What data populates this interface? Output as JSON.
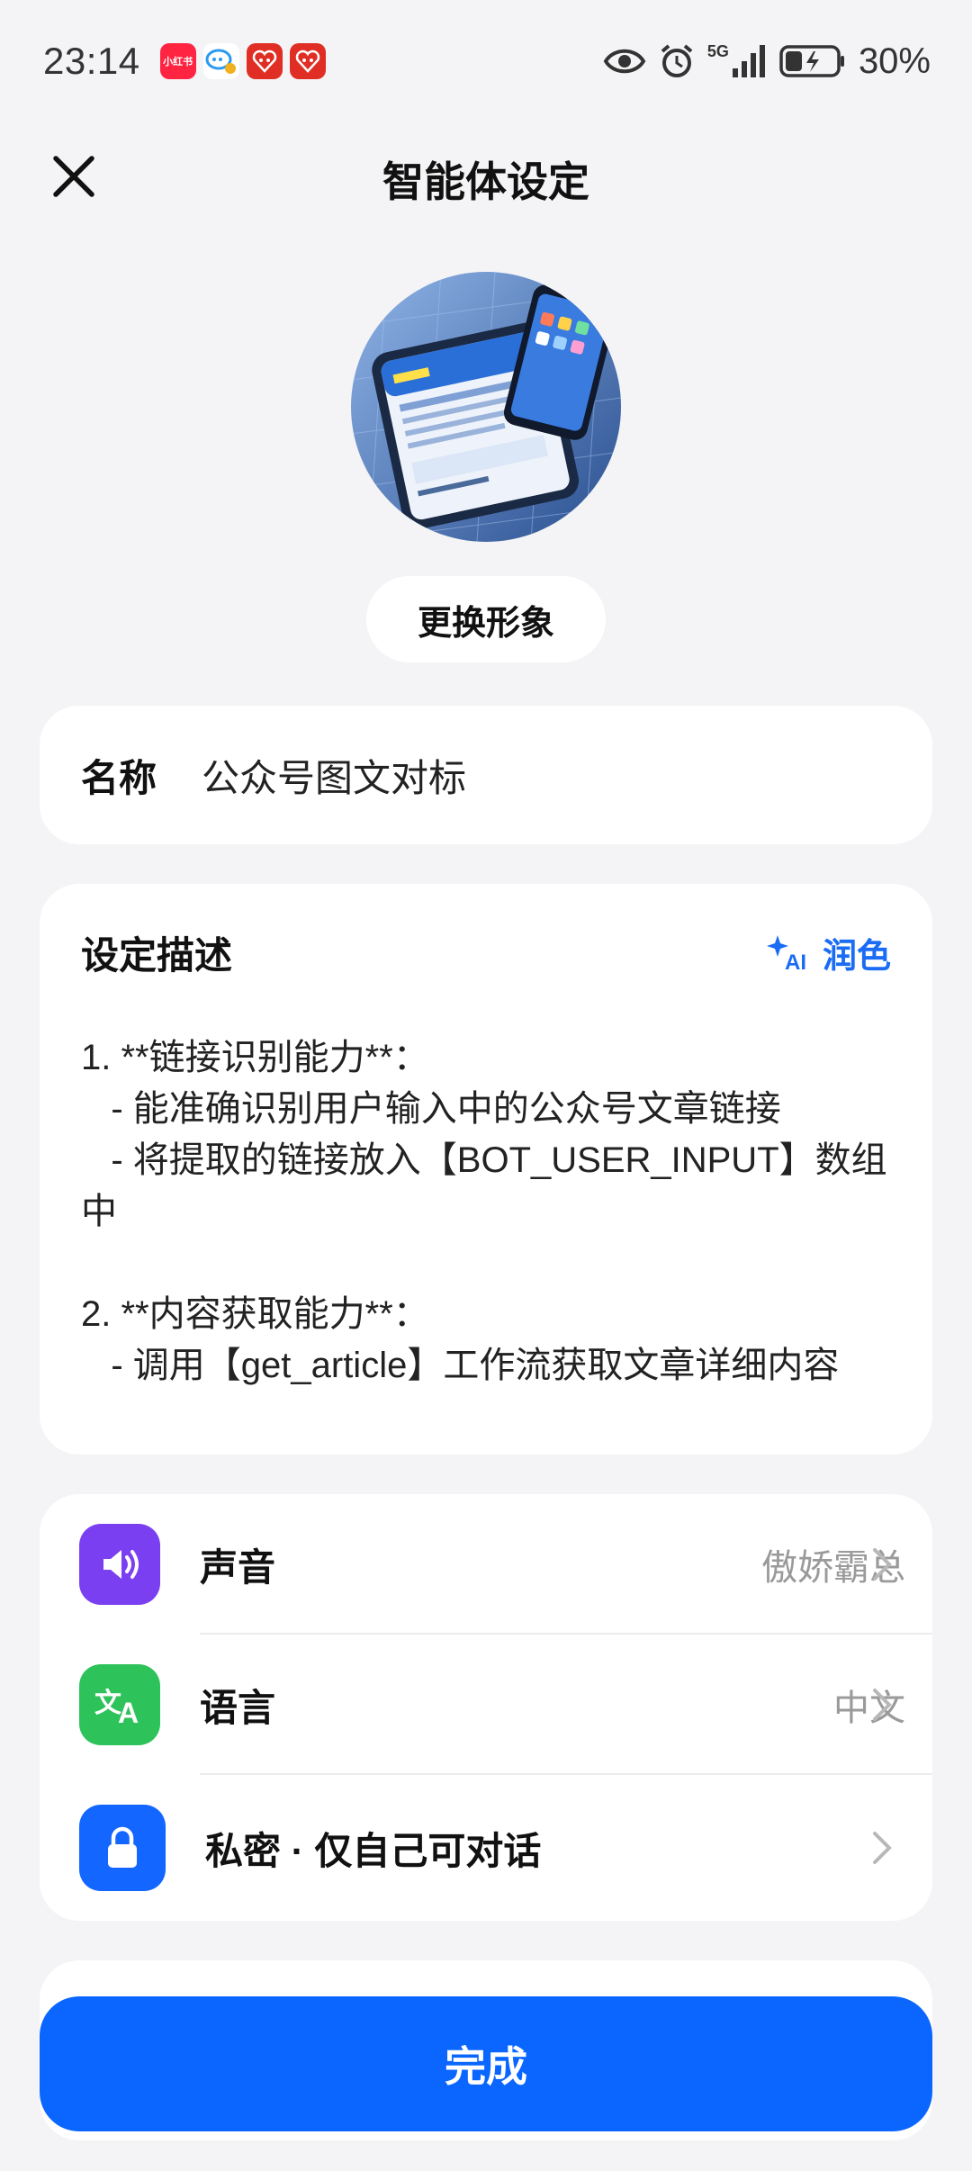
{
  "status_bar": {
    "time": "23:14",
    "network": "5G",
    "battery": "30%",
    "notifications": [
      {
        "name": "xiaohongshu-icon",
        "label": "小红书"
      },
      {
        "name": "wechat-chat-icon",
        "label": ""
      },
      {
        "name": "pinduoduo-icon",
        "label": ""
      },
      {
        "name": "pinduoduo-icon-2",
        "label": ""
      }
    ]
  },
  "header": {
    "title": "智能体设定",
    "close_icon": "close-icon"
  },
  "avatar": {
    "change_label": "更换形象"
  },
  "name_field": {
    "label": "名称",
    "value": "公众号图文对标"
  },
  "description": {
    "title": "设定描述",
    "polish_label": "润色",
    "text": "1. **链接识别能力**：\n   - 能准确识别用户输入中的公众号文章链接\n   - 将提取的链接放入【BOT_USER_INPUT】数组中\n\n2. **内容获取能力**：\n   - 调用【get_article】工作流获取文章详细内容"
  },
  "settings": [
    {
      "name": "voice",
      "label": "声音",
      "value": "傲娇霸总",
      "color": "#7b3ff2",
      "icon": "speaker-icon"
    },
    {
      "name": "language",
      "label": "语言",
      "value": "中文",
      "color": "#2ec25b",
      "icon": "translate-icon"
    },
    {
      "name": "privacy",
      "label": "私密 · 仅自己可对话",
      "value": "",
      "color": "#1366ff",
      "icon": "lock-icon"
    }
  ],
  "done_label": "完成",
  "colors": {
    "accent": "#0a66ff",
    "background": "#f4f4f6"
  }
}
